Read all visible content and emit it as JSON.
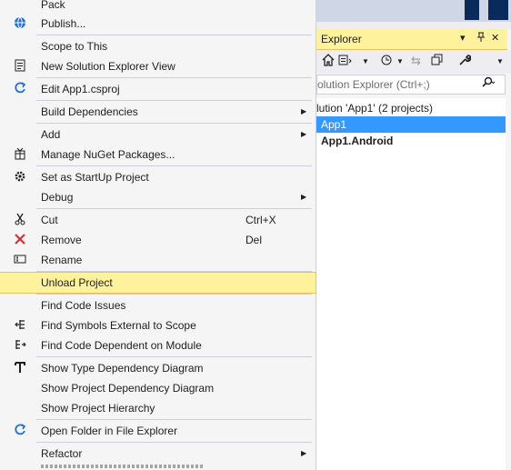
{
  "solution_explorer": {
    "title": "Explorer",
    "title_buttons": [
      "▾",
      "⊓",
      "✕"
    ],
    "search_placeholder": "olution Explorer (Ctrl+;)",
    "tree": [
      {
        "label": "lution 'App1' (2 projects)",
        "selected": false,
        "bold": false
      },
      {
        "label": "App1",
        "selected": true,
        "bold": false
      },
      {
        "label": "App1.Android",
        "selected": false,
        "bold": true
      }
    ]
  },
  "menu": {
    "items": [
      {
        "label": "Pack",
        "icon": null
      },
      {
        "label": "Publish...",
        "icon": "globe-icon"
      },
      {
        "label": "Scope to This",
        "icon": null
      },
      {
        "label": "New Solution Explorer View",
        "icon": "new-view-icon"
      },
      {
        "label": "Edit App1.csproj",
        "icon": "edit-arrow-icon"
      },
      {
        "label": "Build Dependencies",
        "icon": null,
        "submenu": true
      },
      {
        "label": "Add",
        "icon": null,
        "submenu": true
      },
      {
        "label": "Manage NuGet Packages...",
        "icon": "nuget-icon"
      },
      {
        "label": "Set as StartUp Project",
        "icon": "gear-icon"
      },
      {
        "label": "Debug",
        "icon": null,
        "submenu": true
      },
      {
        "label": "Cut",
        "icon": "scissors-icon",
        "shortcut": "Ctrl+X"
      },
      {
        "label": "Remove",
        "icon": "remove-icon",
        "shortcut": "Del"
      },
      {
        "label": "Rename",
        "icon": "rename-icon"
      },
      {
        "label": "Unload Project",
        "icon": null,
        "highlighted": true
      },
      {
        "label": "Find Code Issues",
        "icon": null
      },
      {
        "label": "Find Symbols External to Scope",
        "icon": "find-symbols-icon"
      },
      {
        "label": "Find Code Dependent on Module",
        "icon": "find-dependent-icon"
      },
      {
        "label": "Show Type Dependency Diagram",
        "icon": "type-diagram-icon"
      },
      {
        "label": "Show Project Dependency Diagram",
        "icon": null
      },
      {
        "label": "Show Project Hierarchy",
        "icon": null
      },
      {
        "label": "Open Folder in File Explorer",
        "icon": "open-folder-icon"
      },
      {
        "label": "Refactor",
        "icon": null,
        "submenu": true
      }
    ]
  },
  "colors": {
    "menu_bg": "#f5f5f5",
    "highlight": "#fff29d",
    "selection": "#3399ff",
    "accent_blue": "#1e6fd9",
    "remove_red": "#d13438"
  }
}
